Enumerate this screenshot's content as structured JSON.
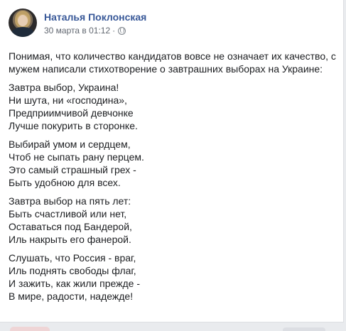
{
  "post": {
    "author": "Наталья Поклонская",
    "date": "30 марта в 01:12",
    "separator": "·",
    "visibility_icon": "globe-icon",
    "intro": [
      "Понимая, что количество кандидатов вовсе не означает их качество, с",
      "мужем написали стихотворение о завтрашних выборах на Украине:"
    ],
    "stanzas": [
      [
        "Завтра выбор, Украина!",
        "Ни шута, ни «господина»,",
        "Предприимчивой девчонке",
        "Лучше покурить в сторонке."
      ],
      [
        "Выбирай умом и сердцем,",
        "Чтоб не сыпать рану перцем.",
        "Это самый страшный грех -",
        "Быть удобною для всех."
      ],
      [
        "Завтра выбор на пять лет:",
        "Быть счастливой или нет,",
        "Оставаться под Бандерой,",
        "Иль накрыть его фанерой."
      ],
      [
        "Слушать, что Россия - враг,",
        "Иль поднять свободы флаг,",
        "И зажить, как жили прежде -",
        "В мире, радости, надежде!"
      ]
    ]
  },
  "colors": {
    "link": "#385898",
    "text": "#1c1e21",
    "meta": "#616770",
    "background": "#e9ebee"
  }
}
